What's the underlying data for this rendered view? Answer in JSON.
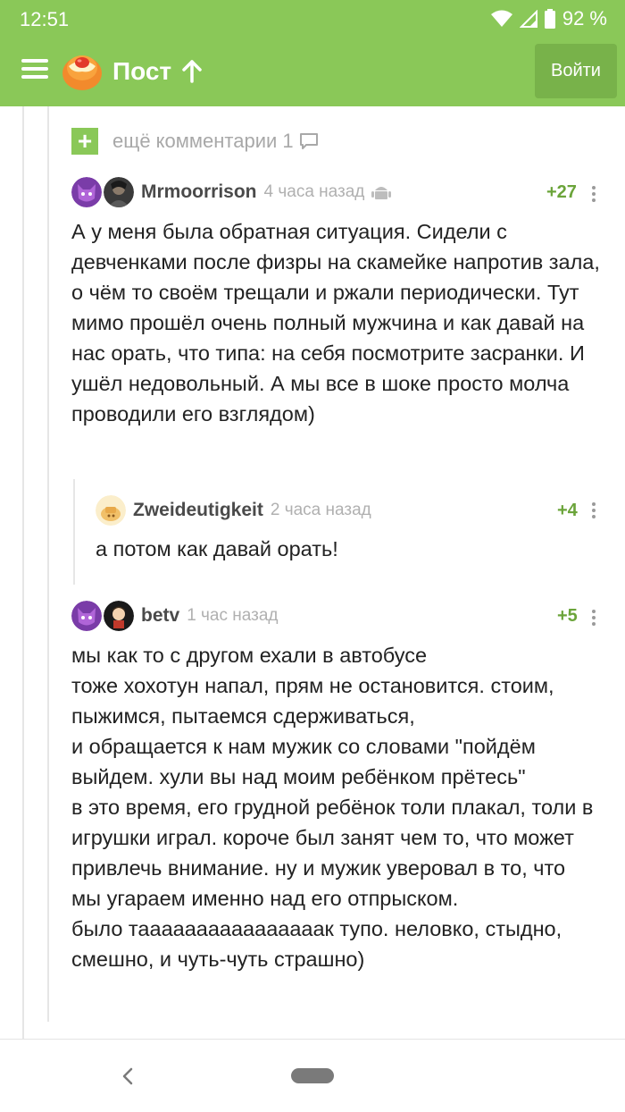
{
  "status_bar": {
    "time": "12:51",
    "battery": "92 %"
  },
  "toolbar": {
    "title": "Пост",
    "login_label": "Войти"
  },
  "more_comments": {
    "label": "ещё комментарии",
    "count": "1"
  },
  "comments": [
    {
      "author": "Mrmoorrison",
      "time": "4 часа назад",
      "rating": "+27",
      "text": "А у меня была обратная ситуация. Сидели с девченками после физры на скамейке напротив зала, о чём то своём трещали и ржали периодически. Тут мимо прошёл очень полный мужчина и как давай на нас орать, что типа: на себя посмотрите засранки. И ушёл недовольный. А мы все в шоке просто молча проводили его взглядом)"
    },
    {
      "author": "Zweideutigkeit",
      "time": "2 часа назад",
      "rating": "+4",
      "text": "а потом как давай орать!"
    },
    {
      "author": "betv",
      "time": "1 час назад",
      "rating": "+5",
      "text": "мы как то с другом ехали в автобусе\nтоже хохотун напал, прям не остановится. стоим, пыжимся, пытаемся сдерживаться,\nи обращается к нам мужик со словами \"пойдём выйдем. хули вы над моим ребёнком прётесь\"\nв это время, его грудной ребёнок толи плакал, толи в игрушки играл. короче был занят чем то, что может привлечь внимание. ну и мужик уверовал в то, что мы угараем именно над его отпрыском.\nбыло таааааааааааааааак тупо. неловко, стыдно, смешно, и чуть-чуть страшно)"
    }
  ],
  "colors": {
    "brand": "#8ac858",
    "rating": "#6ba43a"
  }
}
